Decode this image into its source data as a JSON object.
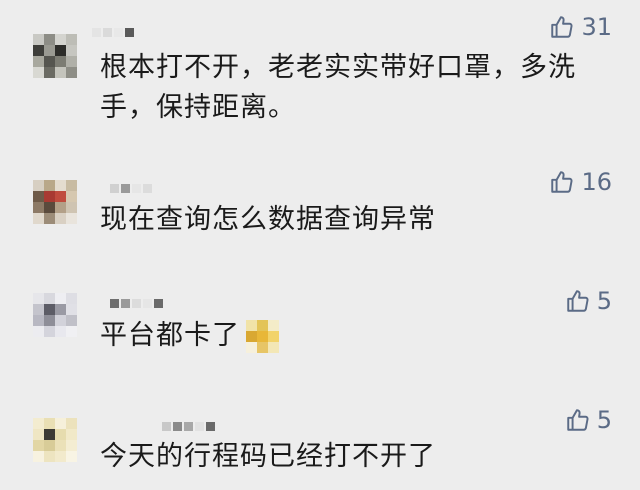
{
  "comments": [
    {
      "text": "根本打不开，老老实实带好口罩，多洗手，保持距离。",
      "likes": "31",
      "like_icon": "thumbs-up-icon"
    },
    {
      "text": "现在查询怎么数据查询异常",
      "likes": "16",
      "like_icon": "thumbs-up-icon"
    },
    {
      "text": "平台都卡了",
      "likes": "5",
      "like_icon": "thumbs-up-icon"
    },
    {
      "text": "今天的行程码已经打不开了",
      "likes": "5",
      "like_icon": "thumbs-up-icon"
    }
  ],
  "colors": {
    "background": "#ededed",
    "text": "#1a1a1a",
    "like": "#5b6b86"
  }
}
